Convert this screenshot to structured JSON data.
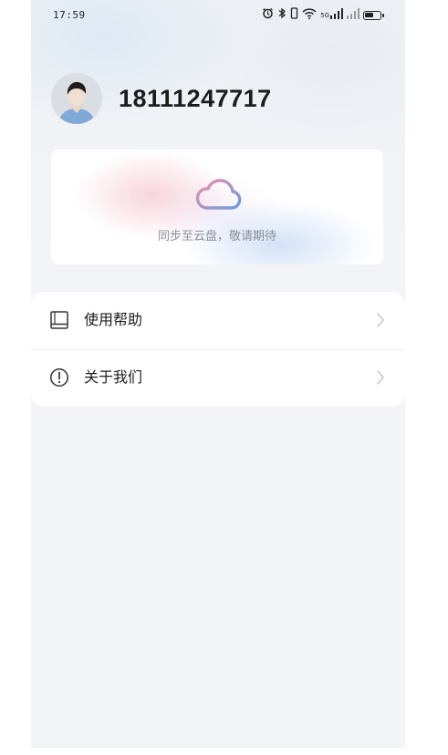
{
  "status_bar": {
    "time": "17:59",
    "network_label": "5G",
    "icons": [
      "alarm-icon",
      "bluetooth-icon",
      "wifi-icon",
      "signal-icon",
      "signal-icon",
      "battery-icon"
    ]
  },
  "profile": {
    "phone": "18111247717"
  },
  "cloud_card": {
    "text": "同步至云盘，敬请期待"
  },
  "menu": {
    "items": [
      {
        "label": "使用帮助",
        "icon": "book-icon"
      },
      {
        "label": "关于我们",
        "icon": "info-circle-icon"
      }
    ]
  },
  "colors": {
    "background": "#f3f4f7",
    "card": "#ffffff",
    "text_primary": "#1c1c1c",
    "text_secondary": "#8a8f96",
    "cloud_gradient_start": "#ee8fa8",
    "cloud_gradient_end": "#6d9be0"
  }
}
